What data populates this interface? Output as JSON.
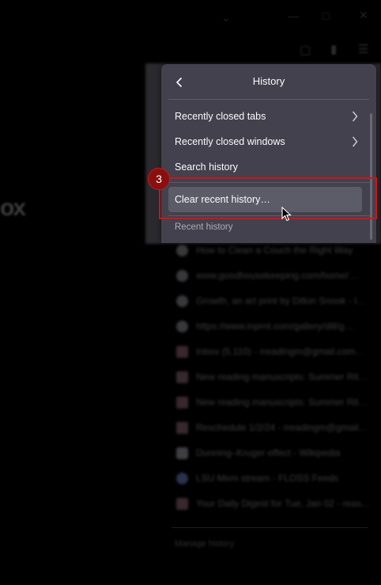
{
  "panel": {
    "title": "History",
    "items": [
      {
        "label": "Recently closed tabs",
        "has_submenu": true
      },
      {
        "label": "Recently closed windows",
        "has_submenu": true
      },
      {
        "label": "Search history",
        "has_submenu": false
      },
      {
        "label": "Clear recent history…",
        "has_submenu": false
      }
    ],
    "section_label": "Recent history",
    "hovered_item": "Clear recent history…"
  },
  "recent_history": [
    {
      "title": "How to Clean a Couch the Right Way",
      "icon": "globe-icon"
    },
    {
      "title": "www.goodhousekeeping.com/home/…",
      "icon": "globe-icon"
    },
    {
      "title": "Growth, an art print by Dillon Snook - I…",
      "icon": "globe-icon"
    },
    {
      "title": "https://www.inprnt.com/gallery/dill/g…",
      "icon": "globe-icon"
    },
    {
      "title": "Inbox (5,110) - rreadingm@gmail.com…",
      "icon": "gmail-icon"
    },
    {
      "title": "New reading manuscripts: Summer Rit…",
      "icon": "gmail-icon"
    },
    {
      "title": "New reading manuscripts: Summer Rit…",
      "icon": "gmail-icon"
    },
    {
      "title": "Reschedule 1/2/24 - rreadingm@gmail…",
      "icon": "gmail-icon"
    },
    {
      "title": "Dunning–Kruger effect - Wikipedia",
      "icon": "wikipedia-icon"
    },
    {
      "title": "LSU Mem stream - FLOSS Feeds",
      "icon": "feed-icon"
    },
    {
      "title": "Your Daily Digest for Tue, Jan 02 - reas…",
      "icon": "gmail-icon"
    }
  ],
  "footer": {
    "label": "Manage history"
  },
  "annotation": {
    "step": "3",
    "color": "#d01417"
  },
  "background_logo": "ox",
  "colors": {
    "panel_bg": "#42414d",
    "hover_bg": "#5c5b68",
    "text": "#fbfbfe"
  }
}
